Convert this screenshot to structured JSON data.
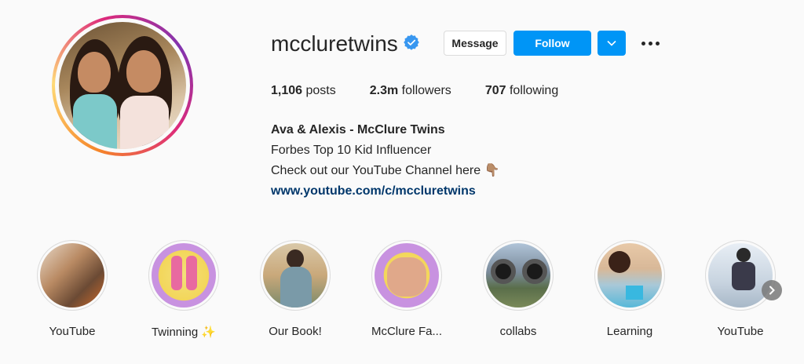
{
  "profile": {
    "username": "mccluretwins",
    "verified": true,
    "buttons": {
      "message": "Message",
      "follow": "Follow"
    },
    "stats": {
      "posts_count": "1,106",
      "posts_label": "posts",
      "followers_count": "2.3m",
      "followers_label": "followers",
      "following_count": "707",
      "following_label": "following"
    },
    "bio": {
      "name": "Ava & Alexis - McClure Twins",
      "line1": "Forbes Top 10 Kid Influencer",
      "line2": "Check out our YouTube Channel here 👇🏽",
      "link": "www.youtube.com/c/mccluretwins"
    }
  },
  "highlights": [
    {
      "label": "YouTube",
      "color": "#a9785a"
    },
    {
      "label": "Twinning ✨",
      "color": "#f3d65a"
    },
    {
      "label": "Our Book!",
      "color": "#c9a87a"
    },
    {
      "label": "McClure Fa...",
      "color": "#d9b4e8"
    },
    {
      "label": "collabs",
      "color": "#7a8a9a"
    },
    {
      "label": "Learning",
      "color": "#a8c8d8"
    },
    {
      "label": "YouTube",
      "color": "#c8d4e0"
    }
  ],
  "colors": {
    "accent": "#0095f6",
    "link": "#00376b",
    "verified": "#3897f0"
  }
}
